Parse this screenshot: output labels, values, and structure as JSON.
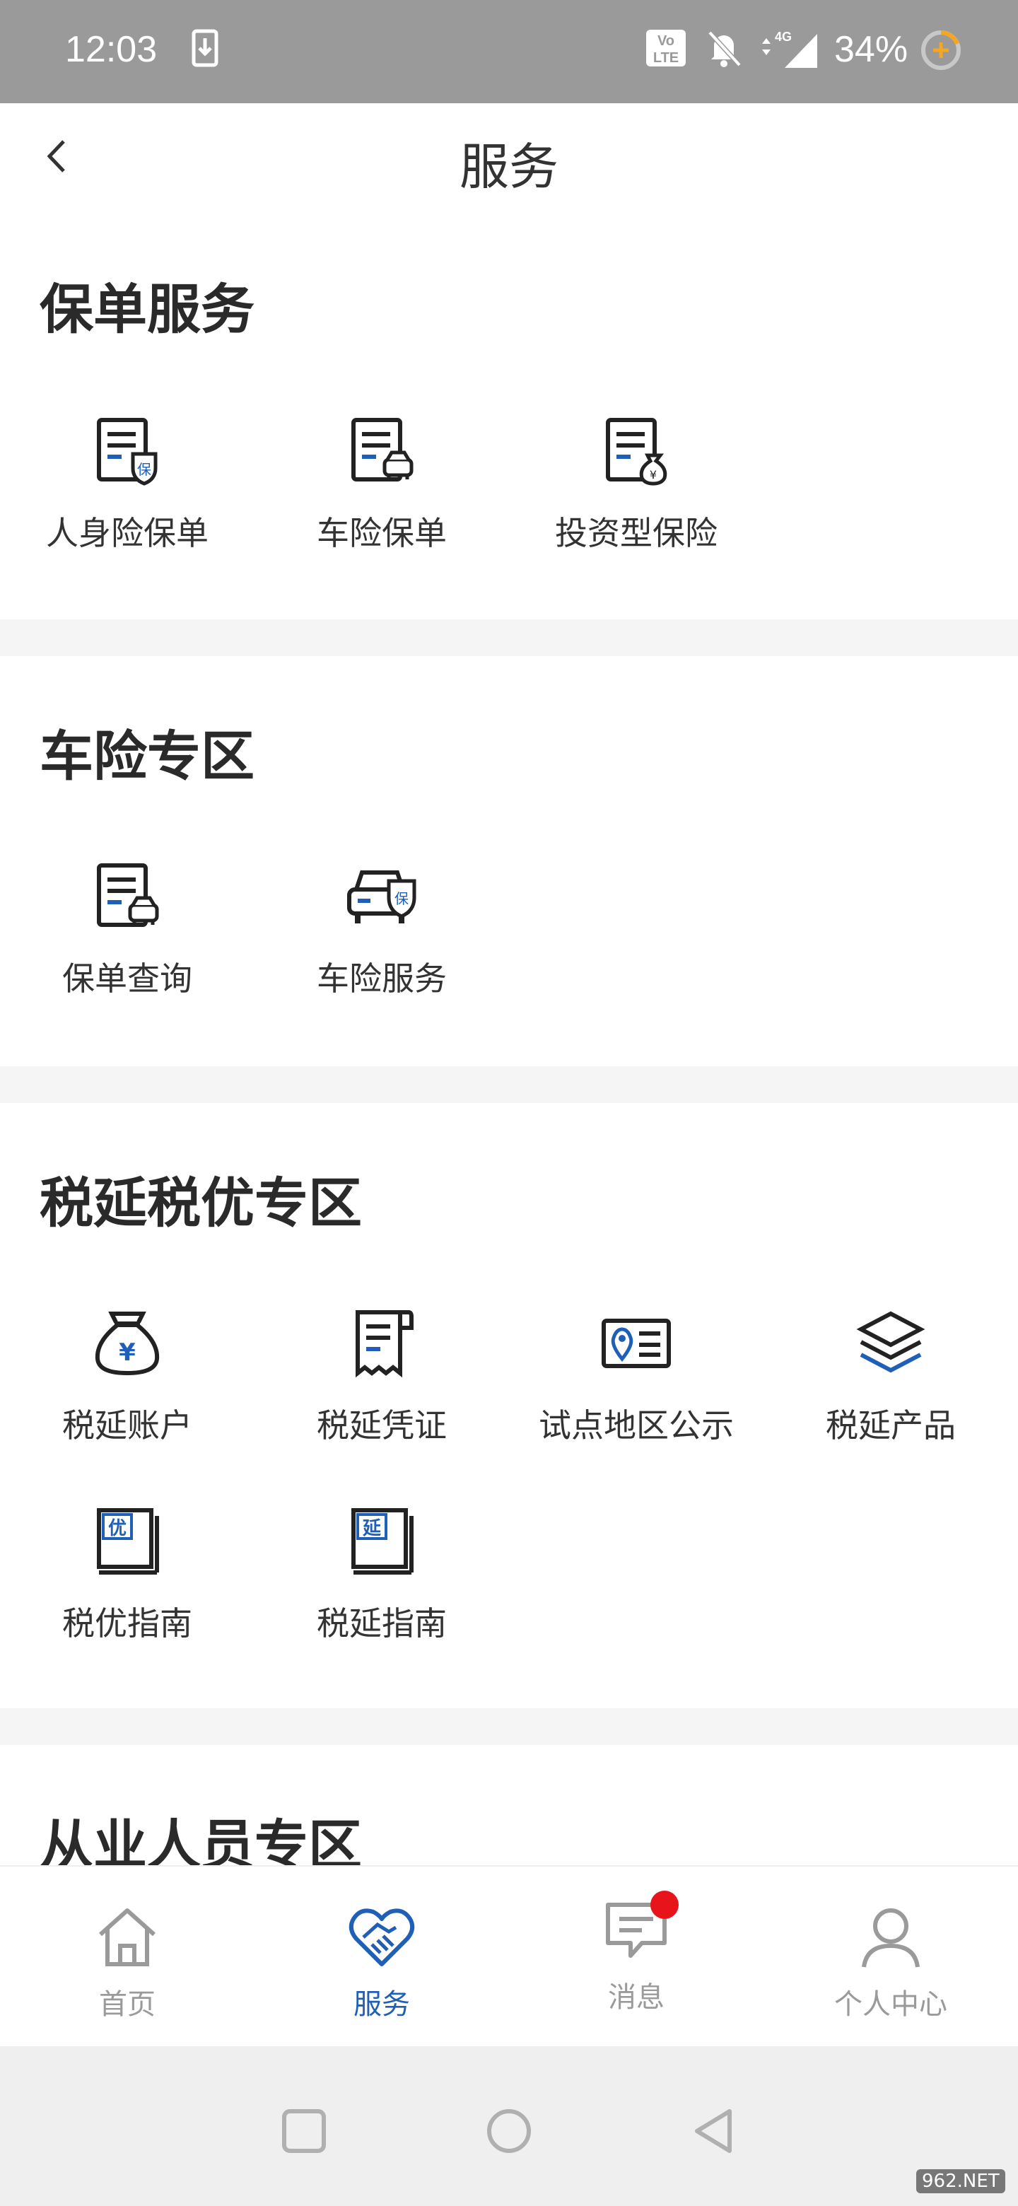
{
  "status_bar": {
    "time": "12:03",
    "battery": "34%",
    "network": "4G",
    "volte": "Vo LTE",
    "icons": [
      "download-icon",
      "volte-icon",
      "bell-off-icon",
      "signal-icon",
      "battery-charging-icon"
    ]
  },
  "header": {
    "title": "服务",
    "back_icon": "chevron-left-icon"
  },
  "sections": {
    "policy": {
      "title": "保单服务",
      "items": [
        {
          "label": "人身险保单",
          "icon": "doc-shield-icon"
        },
        {
          "label": "车险保单",
          "icon": "doc-car-icon"
        },
        {
          "label": "投资型保险",
          "icon": "doc-moneybag-icon"
        }
      ]
    },
    "car": {
      "title": "车险专区",
      "items": [
        {
          "label": "保单查询",
          "icon": "doc-car-icon"
        },
        {
          "label": "车险服务",
          "icon": "car-shield-icon"
        }
      ]
    },
    "tax": {
      "title": "税延税优专区",
      "items": [
        {
          "label": "税延账户",
          "icon": "money-bag-icon"
        },
        {
          "label": "税延凭证",
          "icon": "receipt-icon"
        },
        {
          "label": "试点地区公示",
          "icon": "map-card-icon"
        },
        {
          "label": "税延产品",
          "icon": "layers-icon"
        },
        {
          "label": "税优指南",
          "icon": "book-you-icon",
          "glyph": "优"
        },
        {
          "label": "税延指南",
          "icon": "book-yan-icon",
          "glyph": "延"
        }
      ]
    },
    "staff": {
      "title": "从业人员专区"
    }
  },
  "tab_bar": {
    "tabs": [
      {
        "label": "首页",
        "icon": "home-icon",
        "active": false
      },
      {
        "label": "服务",
        "icon": "heart-handshake-icon",
        "active": true
      },
      {
        "label": "消息",
        "icon": "message-icon",
        "active": false,
        "badge": true
      },
      {
        "label": "个人中心",
        "icon": "user-icon",
        "active": false
      }
    ]
  },
  "nav_bar": {
    "buttons": [
      "recents-button",
      "home-button",
      "back-button"
    ]
  },
  "watermark": "962.NET",
  "colors": {
    "accent": "#1f5fb8",
    "badge": "#e8141c",
    "status_bar": "#9a9a9a",
    "divider": "#f5f5f5",
    "inactive": "#9a9a9a",
    "icon_dark": "#222222"
  }
}
